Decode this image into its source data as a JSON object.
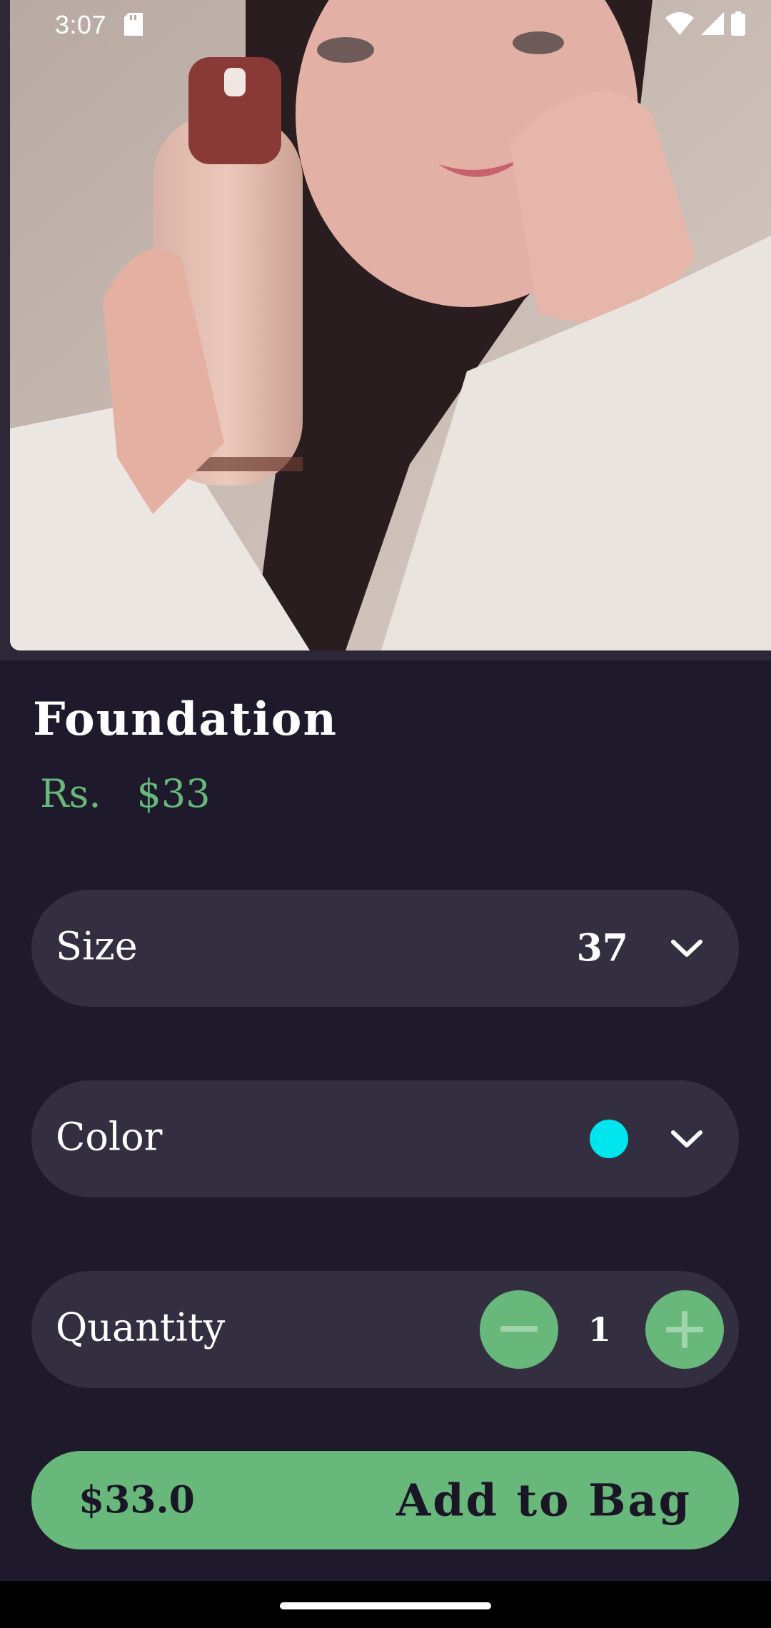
{
  "status_bar": {
    "time": "3:07"
  },
  "product": {
    "title": "Foundation",
    "price_currency": "Rs.",
    "price": "$33"
  },
  "options": {
    "size_label": "Size",
    "size_value": "37",
    "color_label": "Color",
    "color_value": "#00e5ee",
    "quantity_label": "Quantity",
    "quantity_value": "1"
  },
  "bag_button": {
    "total": "$33.0",
    "label": "Add to Bag"
  },
  "colors": {
    "background": "#1e1a2c",
    "card": "#332f41",
    "accent": "#67b87a"
  }
}
